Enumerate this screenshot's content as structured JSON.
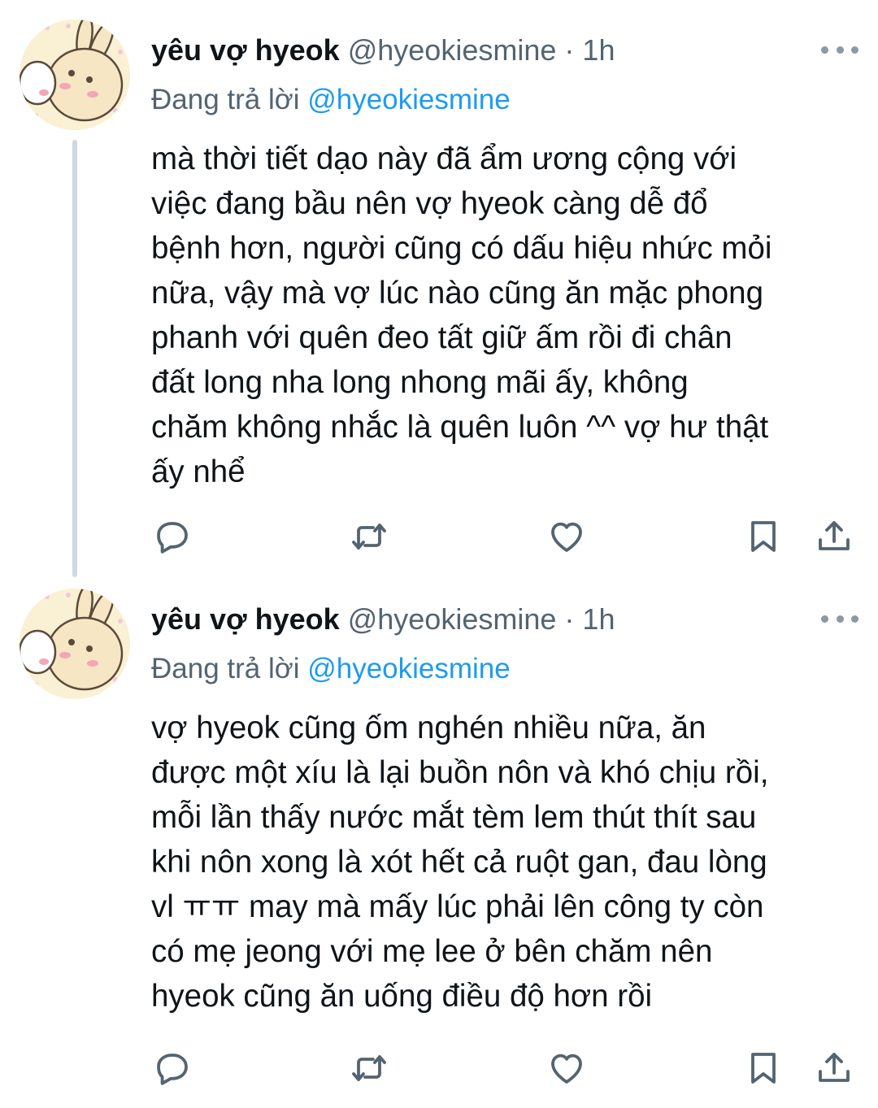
{
  "tweets": [
    {
      "author_name": "yêu vợ hyeok",
      "handle": "@hyeokiesmine",
      "separator": "·",
      "time": "1h",
      "reply_prefix": "Đang trả lời",
      "reply_to": "@hyeokiesmine",
      "text": "mà thời tiết dạo này đã ẩm ương cộng với\nviệc đang bầu nên vợ hyeok càng dễ đổ\nbệnh hơn, người cũng có dấu hiệu nhức mỏi\nnữa, vậy mà vợ lúc nào cũng ăn mặc phong\nphanh với quên đeo tất giữ ấm rồi đi chân\nđất long nha long nhong mãi ấy, không\nchăm không nhắc là quên luôn ^^ vợ hư thật\nấy nhể"
    },
    {
      "author_name": "yêu vợ hyeok",
      "handle": "@hyeokiesmine",
      "separator": "·",
      "time": "1h",
      "reply_prefix": "Đang trả lời",
      "reply_to": "@hyeokiesmine",
      "text": "vợ hyeok cũng ốm nghén nhiều nữa, ăn\nđược một xíu là lại buồn nôn và khó chịu rồi,\nmỗi lần thấy nước mắt tèm lem thút thít sau\nkhi nôn xong là xót hết cả ruột gan, đau lòng\nvl ㅠㅠ may mà mấy lúc phải lên công ty còn\ncó mẹ jeong với mẹ lee ở bên chăm nên\nhyeok cũng ăn uống điều độ hơn rồi"
    }
  ],
  "icons": {
    "reply": "reply-icon",
    "retweet": "retweet-icon",
    "like": "heart-icon",
    "bookmark": "bookmark-icon",
    "share": "share-icon",
    "more": "more-dots-icon"
  },
  "colors": {
    "text": "#0f1419",
    "secondary": "#536471",
    "mention": "#1d9bf0",
    "thread_line": "#cfd9de",
    "avatar_bg": "#faf1d4"
  }
}
